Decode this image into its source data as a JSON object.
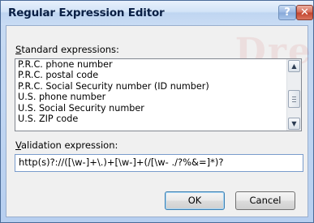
{
  "window": {
    "title": "Regular Expression Editor",
    "help_glyph": "?",
    "close_glyph": "✕",
    "watermark": "Dre"
  },
  "standard": {
    "label_accel": "S",
    "label_rest": "tandard expressions:",
    "items": [
      "P.R.C. phone number",
      "P.R.C. postal code",
      "P.R.C. Social Security number (ID number)",
      "U.S. phone number",
      "U.S. Social Security number",
      "U.S. ZIP code"
    ],
    "scroll_up": "▲",
    "scroll_down": "▼"
  },
  "validation": {
    "label_accel": "V",
    "label_rest": "alidation expression:",
    "value": "http(s)?://([\\w-]+\\.)+[\\w-]+(/[\\w- ./?%&=]*)?"
  },
  "buttons": {
    "ok": "OK",
    "cancel": "Cancel"
  }
}
